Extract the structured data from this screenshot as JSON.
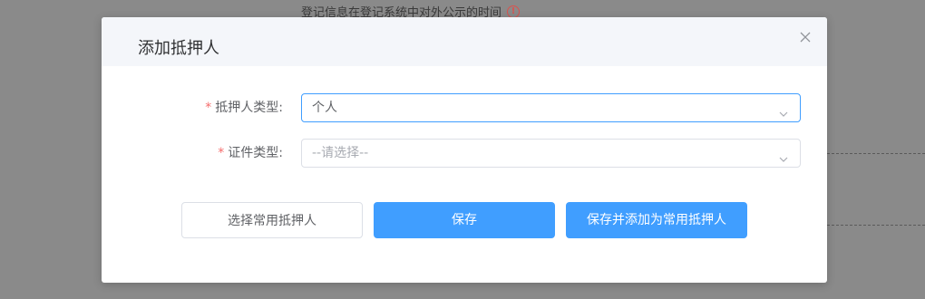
{
  "background": {
    "note_text": "登记信息在登记系统中对外公示的时间",
    "note_icon": "warning-circle-icon"
  },
  "dialog": {
    "title": "添加抵押人",
    "close_icon": "close-icon",
    "fields": [
      {
        "label": "抵押人类型:",
        "required": true,
        "value": "个人",
        "placeholder": ""
      },
      {
        "label": "证件类型:",
        "required": true,
        "value": "",
        "placeholder": "--请选择--"
      }
    ],
    "buttons": {
      "select_common": "选择常用抵押人",
      "save": "保存",
      "save_and_add": "保存并添加为常用抵押人"
    }
  },
  "colors": {
    "primary": "#409eff",
    "required": "#f56c6c",
    "overlay": "#8a8a8a"
  }
}
